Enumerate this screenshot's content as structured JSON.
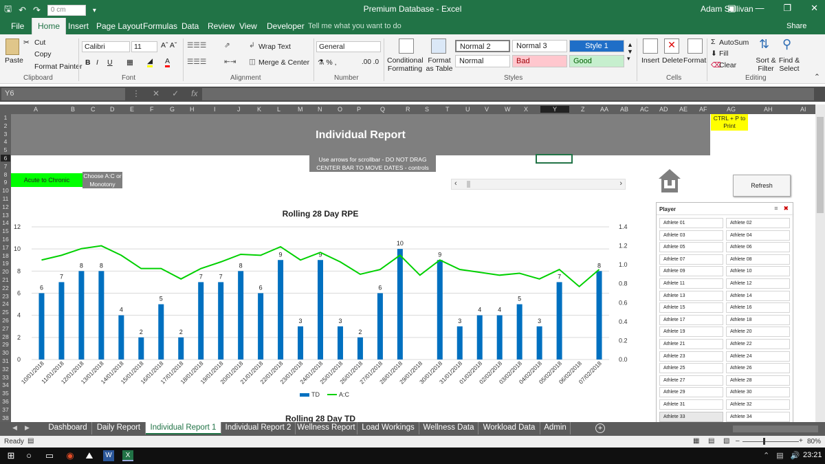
{
  "titlebar": {
    "zoom_box": "0 cm",
    "document_title": "Premium Database  -  Excel",
    "user": "Adam Sullivan"
  },
  "ribbon_tabs": [
    "File",
    "Home",
    "Insert",
    "Page Layout",
    "Formulas",
    "Data",
    "Review",
    "View",
    "Developer"
  ],
  "tell_me": "Tell me what you want to do",
  "share": "Share",
  "ribbon": {
    "clipboard": {
      "label": "Clipboard",
      "paste": "Paste",
      "cut": "Cut",
      "copy": "Copy",
      "format_painter": "Format Painter"
    },
    "font": {
      "label": "Font",
      "name": "Calibri",
      "size": "11"
    },
    "alignment": {
      "label": "Alignment",
      "wrap_text": "Wrap Text",
      "merge_center": "Merge & Center"
    },
    "number": {
      "label": "Number",
      "format": "General"
    },
    "styles": {
      "label": "Styles",
      "conditional": "Conditional Formatting",
      "format_as_table": "Format as Table",
      "normal2": "Normal 2",
      "normal3": "Normal 3",
      "style1": "Style 1",
      "normal": "Normal",
      "bad": "Bad",
      "good": "Good"
    },
    "cells": {
      "label": "Cells",
      "insert": "Insert",
      "delete": "Delete",
      "format": "Format"
    },
    "editing": {
      "label": "Editing",
      "autosum": "AutoSum",
      "fill": "Fill",
      "clear": "Clear",
      "sort_filter": "Sort & Filter",
      "find_select": "Find & Select"
    }
  },
  "formula_bar": {
    "name_box": "Y6",
    "formula": ""
  },
  "columns": [
    "A",
    "B",
    "C",
    "D",
    "E",
    "F",
    "G",
    "H",
    "I",
    "J",
    "K",
    "L",
    "M",
    "N",
    "O",
    "P",
    "Q",
    "R",
    "S",
    "T",
    "U",
    "V",
    "W",
    "X",
    "Y",
    "Z",
    "AA",
    "AB",
    "AC",
    "AD",
    "AE",
    "AF",
    "AG",
    "AH",
    "AI"
  ],
  "rows": [
    "1",
    "2",
    "3",
    "4",
    "5",
    "6",
    "7",
    "8",
    "9",
    "10",
    "11",
    "12",
    "13",
    "14",
    "15",
    "16",
    "17",
    "18",
    "19",
    "20",
    "21",
    "22",
    "23",
    "24",
    "25",
    "26",
    "27",
    "28",
    "29",
    "30",
    "31",
    "32",
    "33",
    "34",
    "35",
    "36",
    "37",
    "38"
  ],
  "sheet": {
    "banner_title": "Individual Report",
    "print_note": "CTRL + P to Print",
    "instructions_line1": "Use arrows for scrollbar - DO NOT DRAG",
    "instructions_line2": "CENTER BAR TO MOVE DATES - controls charts",
    "acute_button": "Acute to Chronic",
    "choose_line1": "Choose A:C or",
    "choose_line2": "Monotony",
    "refresh": "Refresh",
    "chart2_title": "Rolling 28 Day TD"
  },
  "slicer": {
    "title": "Player",
    "selected": "Athlete 33",
    "items": [
      "Athlete 01",
      "Athlete 02",
      "Athlete 03",
      "Athlete 04",
      "Athlete 05",
      "Athlete 06",
      "Athlete 07",
      "Athlete 08",
      "Athlete 09",
      "Athlete 10",
      "Athlete 11",
      "Athlete 12",
      "Athlete 13",
      "Athlete 14",
      "Athlete 15",
      "Athlete 16",
      "Athlete 17",
      "Athlete 18",
      "Athlete 19",
      "Athlete 20",
      "Athlete 21",
      "Athlete 22",
      "Athlete 23",
      "Athlete 24",
      "Athlete 25",
      "Athlete 26",
      "Athlete 27",
      "Athlete 28",
      "Athlete 29",
      "Athlete 30",
      "Athlete 31",
      "Athlete 32",
      "Athlete 33",
      "Athlete 34"
    ]
  },
  "chart_data": {
    "type": "bar",
    "title": "Rolling 28 Day RPE",
    "categories": [
      "10/01/2018",
      "11/01/2018",
      "12/01/2018",
      "13/01/2018",
      "14/01/2018",
      "15/01/2018",
      "16/01/2018",
      "17/01/2018",
      "18/01/2018",
      "19/01/2018",
      "20/01/2018",
      "21/01/2018",
      "22/01/2018",
      "23/01/2018",
      "24/01/2018",
      "25/01/2018",
      "26/01/2018",
      "27/01/2018",
      "28/01/2018",
      "29/01/2018",
      "30/01/2018",
      "31/01/2018",
      "01/02/2018",
      "02/02/2018",
      "03/02/2018",
      "04/02/2018",
      "05/02/2018",
      "06/02/2018",
      "07/02/2018"
    ],
    "series": [
      {
        "name": "TD",
        "type": "bar",
        "axis": "left",
        "color": "#0070c0",
        "values": [
          6,
          7,
          8,
          8,
          4,
          2,
          5,
          2,
          7,
          7,
          8,
          6,
          9,
          3,
          9,
          3,
          2,
          6,
          10,
          null,
          9,
          3,
          4,
          4,
          5,
          3,
          7,
          null,
          8
        ]
      },
      {
        "name": "A:C",
        "type": "line",
        "axis": "right",
        "color": "#00d000",
        "values": [
          1.05,
          1.1,
          1.17,
          1.2,
          1.1,
          0.96,
          0.96,
          0.85,
          0.96,
          1.03,
          1.11,
          1.1,
          1.19,
          1.05,
          1.13,
          1.03,
          0.9,
          0.95,
          1.1,
          0.89,
          1.05,
          0.95,
          0.92,
          0.89,
          0.91,
          0.85,
          0.95,
          0.77,
          0.95
        ]
      }
    ],
    "ylim": [
      0,
      12
    ],
    "yticks": [
      0,
      2,
      4,
      6,
      8,
      10,
      12
    ],
    "y2lim": [
      0,
      1.4
    ],
    "y2ticks": [
      "0.0",
      "0.2",
      "0.4",
      "0.6",
      "0.8",
      "1.0",
      "1.2",
      "1.4"
    ],
    "legend": "bottom",
    "grid": true
  },
  "sheet_tabs": [
    "Dashboard",
    "Daily Report",
    "Individual Report 1",
    "Individual Report 2",
    "Wellness Report",
    "Load Workings",
    "Wellness Data",
    "Workload Data",
    "Admin"
  ],
  "active_sheet": "Individual Report 1",
  "status": {
    "ready": "Ready",
    "zoom": "80%"
  },
  "taskbar": {
    "time": "23:21"
  },
  "colors": {
    "excel_green": "#217346",
    "bar_blue": "#0070c0",
    "line_green": "#00d000",
    "acute_green": "#00ff00",
    "print_yellow": "#ffff00"
  }
}
